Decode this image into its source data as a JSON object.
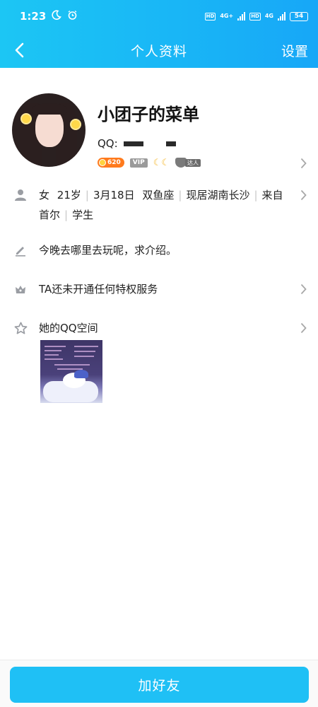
{
  "status_bar": {
    "time": "1:23",
    "battery": "54",
    "network_1": "4G+",
    "network_2": "4G",
    "hd_1": "HD",
    "hd_2": "HD"
  },
  "nav": {
    "title": "个人资料",
    "settings_label": "设置"
  },
  "profile": {
    "name": "小团子的菜单",
    "qq_label": "QQ:",
    "level": "620",
    "vip": "VIP",
    "talent": "达人"
  },
  "info": {
    "gender": "女",
    "age": "21岁",
    "birthday": "3月18日",
    "zodiac": "双鱼座",
    "location": "现居湖南长沙",
    "hometown": "来自首尔",
    "occupation": "学生"
  },
  "signature": "今晚去哪里去玩呢，求介绍。",
  "privilege": "TA还未开通任何特权服务",
  "qzone_label": "她的QQ空间",
  "add_friend_label": "加好友",
  "colors": {
    "header_gradient_start": "#1cc6f4",
    "header_gradient_end": "#17a7f7",
    "add_friend_button": "#1fc0f5",
    "level_badge": "#ff7a1c"
  }
}
